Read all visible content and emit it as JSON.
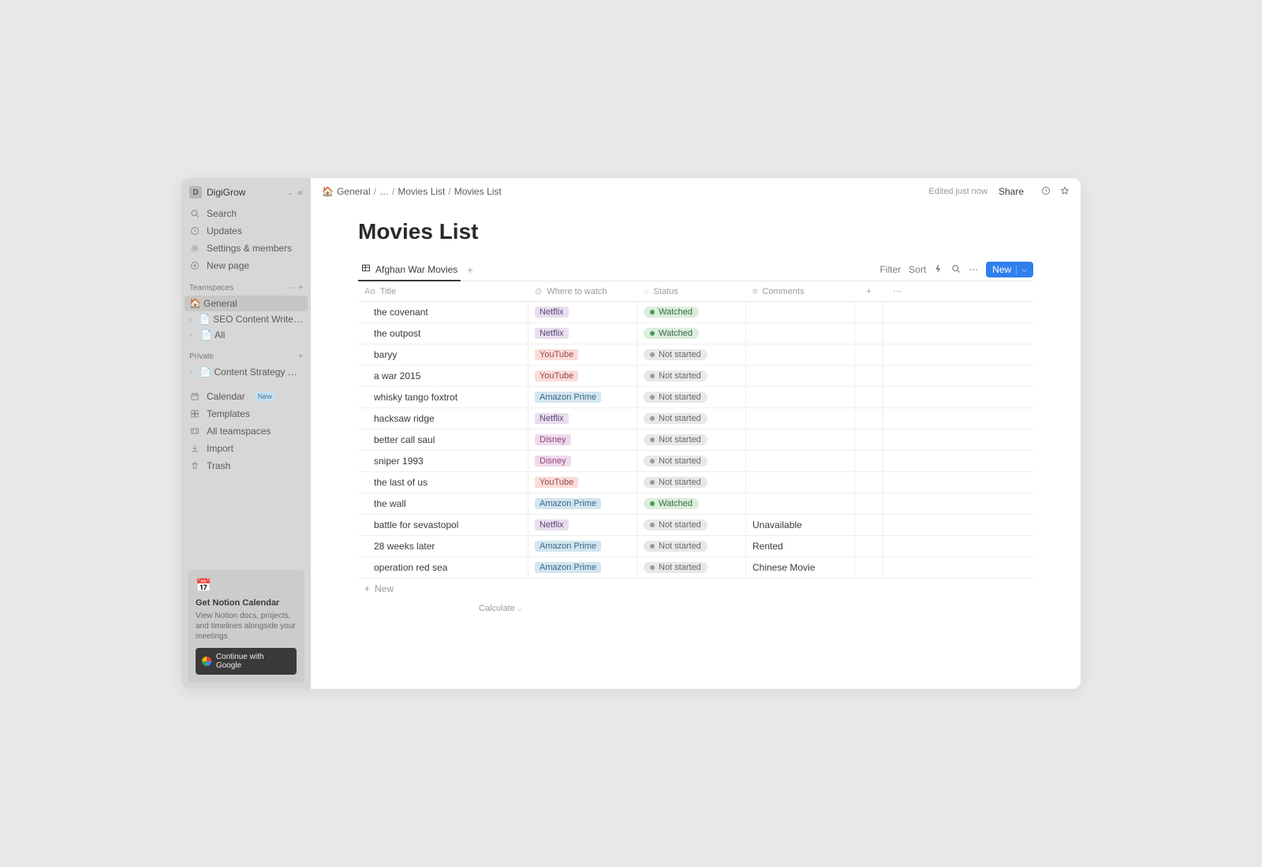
{
  "workspace": {
    "initial": "D",
    "name": "DigiGrow"
  },
  "sidebar": {
    "search": "Search",
    "updates": "Updates",
    "settings": "Settings & members",
    "newpage": "New page",
    "teamspaces_label": "Teamspaces",
    "private_label": "Private",
    "teamspaces": [
      {
        "icon": "🏠",
        "label": "General"
      },
      {
        "icon": "📄",
        "label": "SEO Content Writer & E…"
      },
      {
        "icon": "📄",
        "label": "All"
      }
    ],
    "private": [
      {
        "icon": "📄",
        "label": "Content Strategy Pitch"
      }
    ],
    "calendar": "Calendar",
    "calendar_badge": "New",
    "templates": "Templates",
    "all_teamspaces": "All teamspaces",
    "import": "Import",
    "trash": "Trash"
  },
  "promo": {
    "title": "Get Notion Calendar",
    "desc": "View Notion docs, projects, and timelines alongside your meetings",
    "button": "Continue with Google"
  },
  "breadcrumbs": [
    "General",
    "…",
    "Movies List",
    "Movies List"
  ],
  "topbar": {
    "edited": "Edited just now",
    "share": "Share"
  },
  "page_title": "Movies List",
  "tab_label": "Afghan War Movies",
  "toolbar": {
    "filter": "Filter",
    "sort": "Sort",
    "new": "New"
  },
  "columns": {
    "title": "Title",
    "watch": "Where to watch",
    "status": "Status",
    "comments": "Comments"
  },
  "rows": [
    {
      "title": "the covenant",
      "watch": "Netflix",
      "watch_class": "pill-netflix",
      "status": "Watched",
      "status_class": "st-watched",
      "comments": ""
    },
    {
      "title": "the outpost",
      "watch": "Netflix",
      "watch_class": "pill-netflix",
      "status": "Watched",
      "status_class": "st-watched",
      "comments": ""
    },
    {
      "title": "baryy",
      "watch": "YouTube",
      "watch_class": "pill-youtube",
      "status": "Not started",
      "status_class": "st-notstarted",
      "comments": ""
    },
    {
      "title": "a war 2015",
      "watch": "YouTube",
      "watch_class": "pill-youtube",
      "status": "Not started",
      "status_class": "st-notstarted",
      "comments": ""
    },
    {
      "title": "whisky tango foxtrot",
      "watch": "Amazon Prime",
      "watch_class": "pill-amazon",
      "status": "Not started",
      "status_class": "st-notstarted",
      "comments": ""
    },
    {
      "title": "hacksaw ridge",
      "watch": "Netflix",
      "watch_class": "pill-netflix",
      "status": "Not started",
      "status_class": "st-notstarted",
      "comments": ""
    },
    {
      "title": "better call saul",
      "watch": "Disney",
      "watch_class": "pill-disney",
      "status": "Not started",
      "status_class": "st-notstarted",
      "comments": ""
    },
    {
      "title": "sniper 1993",
      "watch": "Disney",
      "watch_class": "pill-disney",
      "status": "Not started",
      "status_class": "st-notstarted",
      "comments": ""
    },
    {
      "title": "the last of us",
      "watch": "YouTube",
      "watch_class": "pill-youtube",
      "status": "Not started",
      "status_class": "st-notstarted",
      "comments": ""
    },
    {
      "title": "the wall",
      "watch": "Amazon Prime",
      "watch_class": "pill-amazon",
      "status": "Watched",
      "status_class": "st-watched",
      "comments": ""
    },
    {
      "title": "battle for sevastopol",
      "watch": "Netflix",
      "watch_class": "pill-netflix",
      "status": "Not started",
      "status_class": "st-notstarted",
      "comments": "Unavailable"
    },
    {
      "title": "28 weeks later",
      "watch": "Amazon Prime",
      "watch_class": "pill-amazon",
      "status": "Not started",
      "status_class": "st-notstarted",
      "comments": "Rented"
    },
    {
      "title": "operation red sea",
      "watch": "Amazon Prime",
      "watch_class": "pill-amazon",
      "status": "Not started",
      "status_class": "st-notstarted",
      "comments": "Chinese Movie"
    }
  ],
  "row_new": "New",
  "calculate": "Calculate"
}
